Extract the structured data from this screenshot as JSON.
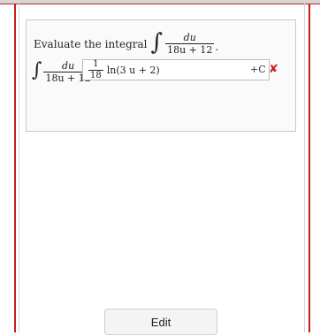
{
  "question": {
    "prompt": "Evaluate the integral",
    "integrand_numerator": "du",
    "integrand_denominator": "18u + 12",
    "prompt_tail": ".",
    "lhs_numerator": "du",
    "lhs_denominator": "18u + 12",
    "answer": {
      "coef_numerator": "1",
      "coef_denominator": "18",
      "expression": "ln(3 u + 2)",
      "constant": "+C"
    },
    "status": "incorrect"
  },
  "buttons": {
    "edit_label": "Edit"
  },
  "colors": {
    "frame": "#c41e1e",
    "wrong_mark": "#d11c1c"
  },
  "icons": {
    "wrong": "x-mark-icon"
  }
}
